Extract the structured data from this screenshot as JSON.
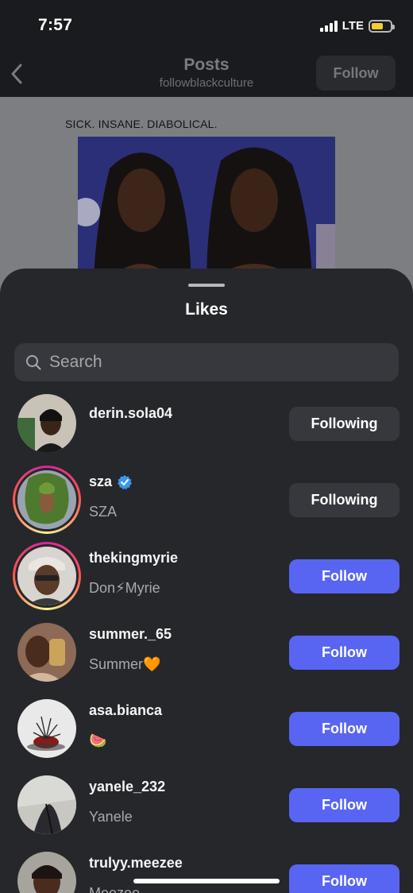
{
  "status_bar": {
    "time": "7:57",
    "network": "LTE",
    "battery_color": "#f1cf2c"
  },
  "nav": {
    "title": "Posts",
    "subtitle": "followblackculture",
    "follow_label": "Follow"
  },
  "post": {
    "caption": "SICK. INSANE. DIABOLICAL."
  },
  "sheet": {
    "title": "Likes",
    "search_placeholder": "Search",
    "users": [
      {
        "username": "derin.sola04",
        "fullname": "",
        "button": "Following",
        "story_ring": false,
        "verified": false
      },
      {
        "username": "sza",
        "fullname": "SZA",
        "button": "Following",
        "story_ring": true,
        "verified": true
      },
      {
        "username": "thekingmyrie",
        "fullname": "Don⚡Myrie",
        "button": "Follow",
        "story_ring": true,
        "verified": false
      },
      {
        "username": "summer._65",
        "fullname": "Summer🧡",
        "button": "Follow",
        "story_ring": false,
        "verified": false
      },
      {
        "username": "asa.bianca",
        "fullname": "🍉",
        "button": "Follow",
        "story_ring": false,
        "verified": false
      },
      {
        "username": "yanele_232",
        "fullname": "Yanele",
        "button": "Follow",
        "story_ring": false,
        "verified": false
      },
      {
        "username": "trulyy.meezee",
        "fullname": "Meezee",
        "button": "Follow",
        "story_ring": false,
        "verified": false
      }
    ]
  },
  "colors": {
    "accent": "#5865f2",
    "sheet_bg": "#25272b",
    "verified": "#3897f0"
  }
}
